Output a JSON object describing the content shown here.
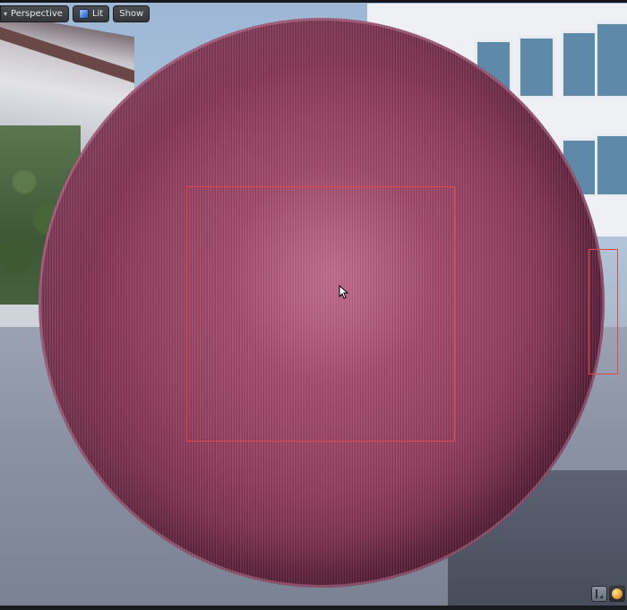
{
  "toolbar": {
    "perspective_label": "Perspective",
    "lit_label": "Lit",
    "show_label": "Show"
  },
  "colors": {
    "selection": "#e24a4a",
    "sphere_base": "#8e3a5a",
    "toolbar_bg": "#3a3c40"
  },
  "icons": {
    "caret": "caret-down-icon",
    "lit": "lit-mode-icon",
    "bottom_left": "stats-icon",
    "bottom_right": "material-preview-icon"
  }
}
